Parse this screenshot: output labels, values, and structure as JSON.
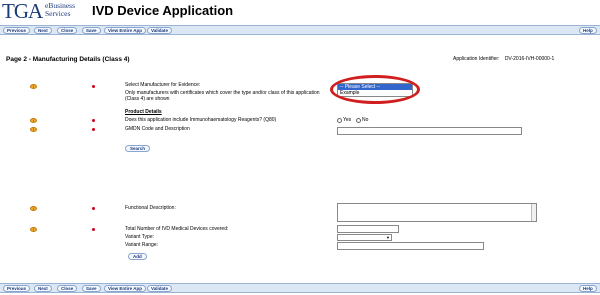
{
  "header": {
    "logo": "TGA",
    "logo_line1": "eBusiness",
    "logo_line2": "Services",
    "title": "IVD Device Application"
  },
  "toolbar": {
    "buttons": [
      "Previous",
      "Next",
      "Close",
      "Save",
      "View Entire App",
      "Validate"
    ],
    "help": "Help"
  },
  "page": {
    "title": "Page 2 - Manufacturing Details (Class 4)",
    "app_identifier_label": "Application Identifier:",
    "app_identifier_value": "DV-2016-IVH-00000-1"
  },
  "form": {
    "manufacturer_label": "Select Manufacturer for Evidence:",
    "manufacturer_note": "Only manufacturers with certificates which cover the type and/or class of this application (Class 4) are shown",
    "manufacturer_options": [
      "-- Please Select --",
      "Example"
    ],
    "product_details_heading": "Product Details",
    "immuno_label": "Does this application include Immunohaematology Reagents? (Q80)",
    "yes_label": "Yes",
    "no_label": "No",
    "gmdn_label": "GMDN Code and Description",
    "search_button": "Search",
    "functional_label": "Functional Description:",
    "total_label": "Total Number of IVD Medical Devices covered:",
    "variant_type_label": "Variant Type:",
    "variant_range_label": "Variant Range:",
    "add_button": "Add"
  },
  "colors": {
    "brand": "#1a3a7a",
    "toolbar_bg": "#dce7f5",
    "highlight_ring": "#d11e1e",
    "required": "#d0021b",
    "warning": "#f2b035"
  }
}
